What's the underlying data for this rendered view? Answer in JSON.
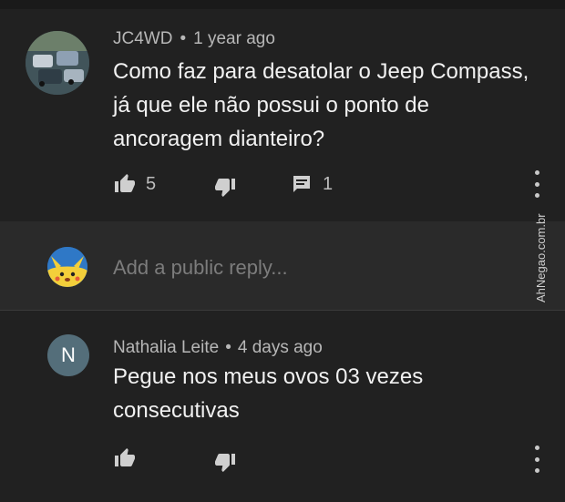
{
  "comment": {
    "author": "JC4WD",
    "time": "1 year ago",
    "separator": "•",
    "text": "Como faz para desatolar o Jeep Compass, já que ele não possui o ponto de ancoragem dianteiro?",
    "likes": "5",
    "replies": "1"
  },
  "reply_box": {
    "placeholder": "Add a public reply..."
  },
  "watermark": "AhNegao.com.br",
  "reply_comment": {
    "avatar_letter": "N",
    "author": "Nathalia Leite",
    "time": "4 days ago",
    "separator": "•",
    "text": "Pegue nos meus ovos 03 vezes consecutivas"
  },
  "colors": {
    "background": "#212121",
    "reply_background": "#2a2a2a",
    "text": "#f1f1f1",
    "meta": "#b7b7b7",
    "avatar_n": "#546e7a"
  }
}
